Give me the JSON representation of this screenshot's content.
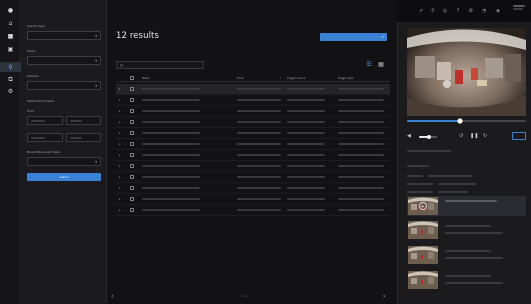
{
  "rail": {
    "items": [
      {
        "name": "logo-icon",
        "glyph": "●"
      },
      {
        "name": "home-icon",
        "glyph": "⌂"
      },
      {
        "name": "camera-icon",
        "glyph": "■"
      },
      {
        "name": "recordings-icon",
        "glyph": "▣"
      },
      {
        "name": "search-icon",
        "glyph": "⚲"
      },
      {
        "name": "export-icon",
        "glyph": "⧉"
      },
      {
        "name": "settings-icon",
        "glyph": "⚙"
      }
    ]
  },
  "filters": {
    "search_type_label": "Search type",
    "search_type_value": "",
    "store_label": "Store",
    "store_value": "",
    "camera_label": "Camera",
    "camera_value": "",
    "time_frame_label": "Select time frame",
    "from_label": "From",
    "to_label": "",
    "boost_label": "Boost NCA event type",
    "boost_value": "",
    "search_button": "Search"
  },
  "results": {
    "title": "12 results",
    "export_button": "",
    "filter_link": "",
    "columns": [
      "Name",
      "Time",
      "Trigger source",
      "Trigger type"
    ],
    "row_count": 12,
    "selected_row": 0
  },
  "pagination": {
    "prev": "‹",
    "next": "›",
    "page": "1 / 1"
  },
  "topbar_icons": [
    {
      "name": "share-icon",
      "glyph": "⇗"
    },
    {
      "name": "filter-icon",
      "glyph": "⚲"
    },
    {
      "name": "info-icon",
      "glyph": "◎"
    },
    {
      "name": "help-icon",
      "glyph": "?"
    },
    {
      "name": "settings-icon",
      "glyph": "⚙"
    },
    {
      "name": "notifications-icon",
      "glyph": "◔"
    },
    {
      "name": "bell-icon",
      "glyph": "◈"
    }
  ],
  "preview": {
    "camera_label": "",
    "more_button": "",
    "thumbnail_count": 4
  },
  "colors": {
    "accent": "#3b82d6",
    "bg": "#0d0d0f"
  }
}
